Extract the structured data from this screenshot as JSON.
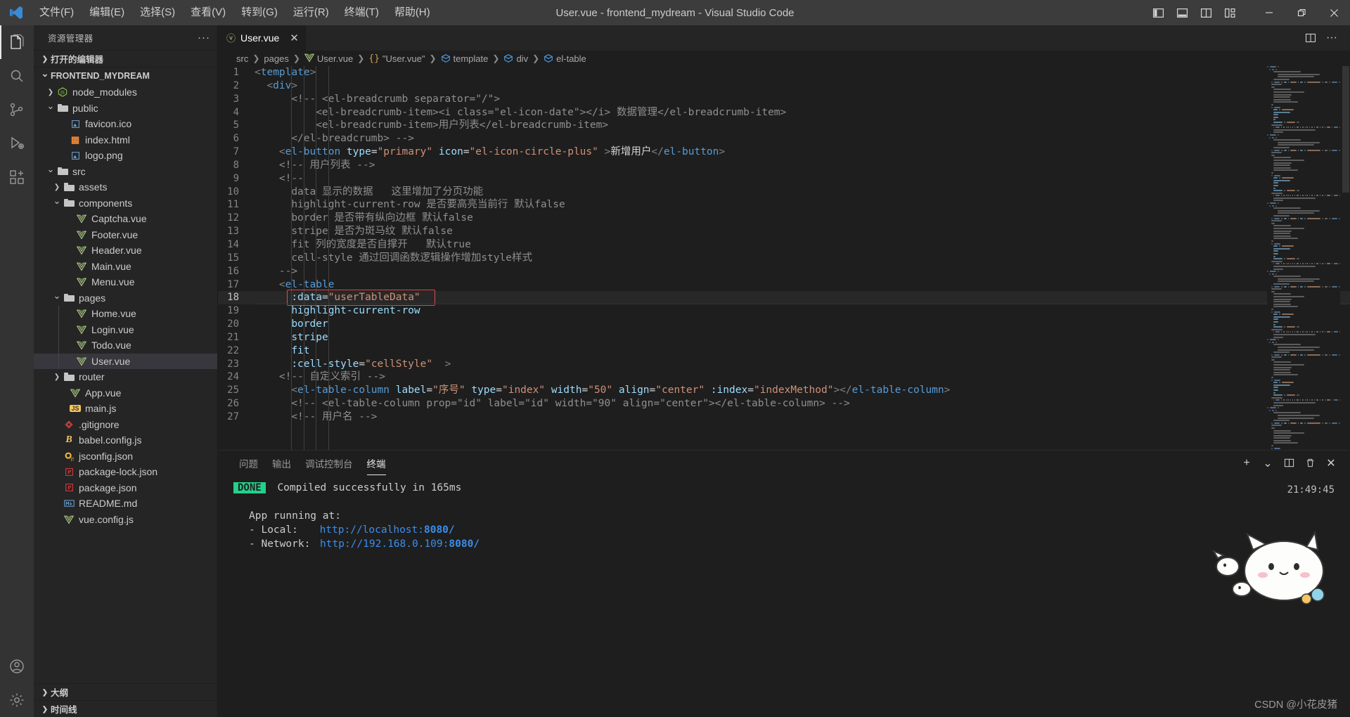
{
  "window": {
    "title": "User.vue - frontend_mydream - Visual Studio Code",
    "logo_icon": "vscode-logo-icon",
    "menus": [
      {
        "label": "文件(F)",
        "name": "menu-file"
      },
      {
        "label": "编辑(E)",
        "name": "menu-edit"
      },
      {
        "label": "选择(S)",
        "name": "menu-selection"
      },
      {
        "label": "查看(V)",
        "name": "menu-view"
      },
      {
        "label": "转到(G)",
        "name": "menu-go"
      },
      {
        "label": "运行(R)",
        "name": "menu-run"
      },
      {
        "label": "终端(T)",
        "name": "menu-terminal"
      },
      {
        "label": "帮助(H)",
        "name": "menu-help"
      }
    ],
    "layout_buttons": [
      {
        "icon": "toggle-primary-sidebar-icon"
      },
      {
        "icon": "toggle-panel-icon"
      },
      {
        "icon": "toggle-secondary-sidebar-icon"
      },
      {
        "icon": "customize-layout-icon"
      }
    ],
    "controls": [
      {
        "icon": "minimize-icon",
        "label": "—"
      },
      {
        "icon": "maximize-icon",
        "label": "❐"
      },
      {
        "icon": "close-icon",
        "label": "✕"
      }
    ]
  },
  "activitybar": [
    {
      "icon": "explorer-icon",
      "active": true
    },
    {
      "icon": "search-icon",
      "active": false
    },
    {
      "icon": "source-control-icon",
      "active": false
    },
    {
      "icon": "run-and-debug-icon",
      "active": false
    },
    {
      "icon": "extensions-icon",
      "active": false
    },
    {
      "icon": "accounts-icon",
      "active": false
    },
    {
      "icon": "settings-gear-icon",
      "active": false
    }
  ],
  "sidebar": {
    "title": "资源管理器",
    "more_icon": "ellipsis-icon",
    "sections": {
      "open_editors": "打开的编辑器",
      "project": "FRONTEND_MYDREAM",
      "outline": "大纲",
      "timeline": "时间线"
    },
    "tree": [
      {
        "label": "node_modules",
        "indent": 1,
        "icon": "nodejs-icon",
        "chevron": "right",
        "type": "folder"
      },
      {
        "label": "public",
        "indent": 1,
        "icon": "folder-icon",
        "chevron": "down",
        "type": "folder"
      },
      {
        "label": "favicon.ico",
        "indent": 3,
        "icon": "image-icon",
        "chevron": "",
        "type": "file"
      },
      {
        "label": "index.html",
        "indent": 3,
        "icon": "html-icon",
        "chevron": "",
        "type": "file"
      },
      {
        "label": "logo.png",
        "indent": 3,
        "icon": "image-icon",
        "chevron": "",
        "type": "file"
      },
      {
        "label": "src",
        "indent": 1,
        "icon": "folder-icon",
        "chevron": "down",
        "type": "folder"
      },
      {
        "label": "assets",
        "indent": 2,
        "icon": "folder-icon",
        "chevron": "right",
        "type": "folder"
      },
      {
        "label": "components",
        "indent": 2,
        "icon": "folder-icon",
        "chevron": "down",
        "type": "folder"
      },
      {
        "label": "Captcha.vue",
        "indent": 4,
        "icon": "vue-icon",
        "chevron": "",
        "type": "file"
      },
      {
        "label": "Footer.vue",
        "indent": 4,
        "icon": "vue-icon",
        "chevron": "",
        "type": "file"
      },
      {
        "label": "Header.vue",
        "indent": 4,
        "icon": "vue-icon",
        "chevron": "",
        "type": "file"
      },
      {
        "label": "Main.vue",
        "indent": 4,
        "icon": "vue-icon",
        "chevron": "",
        "type": "file"
      },
      {
        "label": "Menu.vue",
        "indent": 4,
        "icon": "vue-icon",
        "chevron": "",
        "type": "file"
      },
      {
        "label": "pages",
        "indent": 2,
        "icon": "folder-icon",
        "chevron": "down",
        "type": "folder"
      },
      {
        "label": "Home.vue",
        "indent": 4,
        "icon": "vue-icon",
        "chevron": "",
        "type": "file",
        "guide": true
      },
      {
        "label": "Login.vue",
        "indent": 4,
        "icon": "vue-icon",
        "chevron": "",
        "type": "file",
        "guide": true
      },
      {
        "label": "Todo.vue",
        "indent": 4,
        "icon": "vue-icon",
        "chevron": "",
        "type": "file",
        "guide": true
      },
      {
        "label": "User.vue",
        "indent": 4,
        "icon": "vue-icon",
        "chevron": "",
        "type": "file",
        "guide": true,
        "selected": true
      },
      {
        "label": "router",
        "indent": 2,
        "icon": "folder-icon",
        "chevron": "right",
        "type": "folder"
      },
      {
        "label": "App.vue",
        "indent": 3,
        "icon": "vue-icon",
        "chevron": "",
        "type": "file"
      },
      {
        "label": "main.js",
        "indent": 3,
        "icon": "js-icon",
        "chevron": "",
        "type": "file"
      },
      {
        "label": ".gitignore",
        "indent": 2,
        "icon": "git-icon",
        "chevron": "",
        "type": "file"
      },
      {
        "label": "babel.config.js",
        "indent": 2,
        "icon": "babel-icon",
        "chevron": "",
        "type": "file"
      },
      {
        "label": "jsconfig.json",
        "indent": 2,
        "icon": "jsconfig-icon",
        "chevron": "",
        "type": "file"
      },
      {
        "label": "package-lock.json",
        "indent": 2,
        "icon": "npm-icon",
        "chevron": "",
        "type": "file"
      },
      {
        "label": "package.json",
        "indent": 2,
        "icon": "npm-icon",
        "chevron": "",
        "type": "file"
      },
      {
        "label": "README.md",
        "indent": 2,
        "icon": "markdown-icon",
        "chevron": "",
        "type": "file"
      },
      {
        "label": "vue.config.js",
        "indent": 2,
        "icon": "vue-icon",
        "chevron": "",
        "type": "file"
      }
    ]
  },
  "editor": {
    "tab": {
      "label": "User.vue",
      "icon": "vue-icon",
      "close_icon": "close-icon"
    },
    "tab_actions": [
      {
        "icon": "split-editor-icon"
      },
      {
        "icon": "more-actions-icon"
      }
    ],
    "breadcrumbs": [
      {
        "label": "src",
        "icon": ""
      },
      {
        "label": "pages",
        "icon": ""
      },
      {
        "label": "User.vue",
        "icon": "vue-icon"
      },
      {
        "label": "\"User.vue\"",
        "icon": "braces-icon"
      },
      {
        "label": "template",
        "icon": "symbol-module-icon"
      },
      {
        "label": "div",
        "icon": "symbol-module-icon"
      },
      {
        "label": "el-table",
        "icon": "symbol-module-icon"
      }
    ],
    "highlight_value": ":data=\"userTableData\"",
    "highlight_line": 18,
    "cursor_line": 18,
    "lines": [
      {
        "n": 1,
        "tokens": [
          {
            "t": "brk",
            "v": "<"
          },
          {
            "t": "tag",
            "v": "template"
          },
          {
            "t": "brk",
            "v": ">"
          }
        ],
        "indent": 0
      },
      {
        "n": 2,
        "tokens": [
          {
            "t": "brk",
            "v": "<"
          },
          {
            "t": "tag",
            "v": "div"
          },
          {
            "t": "brk",
            "v": ">"
          }
        ],
        "indent": 1
      },
      {
        "n": 3,
        "tokens": [
          {
            "t": "cmt2",
            "v": "<!-- <el-breadcrumb separator=\"/\">"
          }
        ],
        "indent": 3
      },
      {
        "n": 4,
        "tokens": [
          {
            "t": "cmt2",
            "v": "<el-breadcrumb-item><i class=\"el-icon-date\"></i> 数据管理</el-breadcrumb-item>"
          }
        ],
        "indent": 5
      },
      {
        "n": 5,
        "tokens": [
          {
            "t": "cmt2",
            "v": "<el-breadcrumb-item>用户列表</el-breadcrumb-item>"
          }
        ],
        "indent": 5
      },
      {
        "n": 6,
        "tokens": [
          {
            "t": "cmt2",
            "v": "</el-breadcrumb> -->"
          }
        ],
        "indent": 3
      },
      {
        "n": 7,
        "tokens": [
          {
            "t": "brk",
            "v": "<"
          },
          {
            "t": "tag",
            "v": "el-button"
          },
          {
            "t": "txt",
            "v": " "
          },
          {
            "t": "attr",
            "v": "type"
          },
          {
            "t": "punct",
            "v": "="
          },
          {
            "t": "str",
            "v": "\"primary\""
          },
          {
            "t": "txt",
            "v": " "
          },
          {
            "t": "attr",
            "v": "icon"
          },
          {
            "t": "punct",
            "v": "="
          },
          {
            "t": "str",
            "v": "\"el-icon-circle-plus\""
          },
          {
            "t": "brk",
            "v": " >"
          },
          {
            "t": "txt",
            "v": "新增用户"
          },
          {
            "t": "brk",
            "v": "</"
          },
          {
            "t": "tag",
            "v": "el-button"
          },
          {
            "t": "brk",
            "v": ">"
          }
        ],
        "indent": 2
      },
      {
        "n": 8,
        "tokens": [
          {
            "t": "cmt2",
            "v": "<!-- 用户列表 -->"
          }
        ],
        "indent": 2
      },
      {
        "n": 9,
        "tokens": [
          {
            "t": "cmt2",
            "v": "<!--"
          }
        ],
        "indent": 2
      },
      {
        "n": 10,
        "tokens": [
          {
            "t": "cmt2",
            "v": "data 显示的数据   这里增加了分页功能"
          }
        ],
        "indent": 3
      },
      {
        "n": 11,
        "tokens": [
          {
            "t": "cmt2",
            "v": "highlight-current-row 是否要高亮当前行 默认false"
          }
        ],
        "indent": 3
      },
      {
        "n": 12,
        "tokens": [
          {
            "t": "cmt2",
            "v": "border 是否带有纵向边框 默认false"
          }
        ],
        "indent": 3
      },
      {
        "n": 13,
        "tokens": [
          {
            "t": "cmt2",
            "v": "stripe 是否为斑马纹 默认false"
          }
        ],
        "indent": 3
      },
      {
        "n": 14,
        "tokens": [
          {
            "t": "cmt2",
            "v": "fit 列的宽度是否自撑开   默认true"
          }
        ],
        "indent": 3
      },
      {
        "n": 15,
        "tokens": [
          {
            "t": "cmt2",
            "v": "cell-style 通过回调函数逻辑操作增加style样式"
          }
        ],
        "indent": 3
      },
      {
        "n": 16,
        "tokens": [
          {
            "t": "cmt2",
            "v": "-->"
          }
        ],
        "indent": 2
      },
      {
        "n": 17,
        "tokens": [
          {
            "t": "brk",
            "v": "<"
          },
          {
            "t": "tag",
            "v": "el-table"
          }
        ],
        "indent": 2
      },
      {
        "n": 18,
        "tokens": [
          {
            "t": "attr",
            "v": ":data"
          },
          {
            "t": "punct",
            "v": "="
          },
          {
            "t": "str",
            "v": "\"userTableData\""
          }
        ],
        "indent": 3
      },
      {
        "n": 19,
        "tokens": [
          {
            "t": "attr",
            "v": "highlight-current-row"
          }
        ],
        "indent": 3
      },
      {
        "n": 20,
        "tokens": [
          {
            "t": "attr",
            "v": "border"
          }
        ],
        "indent": 3
      },
      {
        "n": 21,
        "tokens": [
          {
            "t": "attr",
            "v": "stripe"
          }
        ],
        "indent": 3
      },
      {
        "n": 22,
        "tokens": [
          {
            "t": "attr",
            "v": "fit"
          }
        ],
        "indent": 3
      },
      {
        "n": 23,
        "tokens": [
          {
            "t": "attr",
            "v": ":cell-style"
          },
          {
            "t": "punct",
            "v": "="
          },
          {
            "t": "str",
            "v": "\"cellStyle\""
          },
          {
            "t": "brk",
            "v": "  >"
          }
        ],
        "indent": 3
      },
      {
        "n": 24,
        "tokens": [
          {
            "t": "cmt2",
            "v": "<!-- 自定义索引 -->"
          }
        ],
        "indent": 2
      },
      {
        "n": 25,
        "tokens": [
          {
            "t": "brk",
            "v": "<"
          },
          {
            "t": "tag",
            "v": "el-table-column"
          },
          {
            "t": "txt",
            "v": " "
          },
          {
            "t": "attr",
            "v": "label"
          },
          {
            "t": "punct",
            "v": "="
          },
          {
            "t": "str",
            "v": "\"序号\""
          },
          {
            "t": "txt",
            "v": " "
          },
          {
            "t": "attr",
            "v": "type"
          },
          {
            "t": "punct",
            "v": "="
          },
          {
            "t": "str",
            "v": "\"index\""
          },
          {
            "t": "txt",
            "v": " "
          },
          {
            "t": "attr",
            "v": "width"
          },
          {
            "t": "punct",
            "v": "="
          },
          {
            "t": "str",
            "v": "\"50\""
          },
          {
            "t": "txt",
            "v": " "
          },
          {
            "t": "attr",
            "v": "align"
          },
          {
            "t": "punct",
            "v": "="
          },
          {
            "t": "str",
            "v": "\"center\""
          },
          {
            "t": "txt",
            "v": " "
          },
          {
            "t": "attr",
            "v": ":index"
          },
          {
            "t": "punct",
            "v": "="
          },
          {
            "t": "str",
            "v": "\"indexMethod\""
          },
          {
            "t": "brk",
            "v": "></"
          },
          {
            "t": "tag",
            "v": "el-table-column"
          },
          {
            "t": "brk",
            "v": ">"
          }
        ],
        "indent": 3
      },
      {
        "n": 26,
        "tokens": [
          {
            "t": "cmt2",
            "v": "<!-- <el-table-column prop=\"id\" label=\"id\" width=\"90\" align=\"center\"></el-table-column> -->"
          }
        ],
        "indent": 3
      },
      {
        "n": 27,
        "tokens": [
          {
            "t": "cmt2",
            "v": "<!-- 用户名 -->"
          }
        ],
        "indent": 3
      }
    ]
  },
  "panel": {
    "tabs": [
      {
        "label": "问题",
        "active": false
      },
      {
        "label": "输出",
        "active": false
      },
      {
        "label": "调试控制台",
        "active": false
      },
      {
        "label": "终端",
        "active": true
      }
    ],
    "actions": [
      {
        "icon": "add-terminal-icon",
        "label": "+"
      },
      {
        "icon": "chevron-down-icon",
        "label": "⌄"
      },
      {
        "icon": "split-terminal-icon",
        "label": "▥"
      },
      {
        "icon": "trash-icon",
        "label": "🗑"
      },
      {
        "icon": "close-panel-icon",
        "label": "✕"
      }
    ],
    "terminal": {
      "status_badge": "DONE",
      "status_text": "Compiled successfully in 165ms",
      "app_running_label": "App running at:",
      "local_label": "- Local:",
      "local_url": "http://localhost:",
      "local_port": "8080/",
      "network_label": "- Network:",
      "network_url": "http://192.168.0.109:",
      "network_port": "8080/",
      "timestamp": "21:49:45"
    }
  },
  "watermark": "CSDN @小花皮猪",
  "colors": {
    "accent_green": "#23d18b",
    "link_blue": "#3b8eea",
    "highlight_red": "#e04a4a",
    "tag_blue": "#569cd6",
    "string_orange": "#ce9178",
    "attr_cyan": "#9cdcfe"
  }
}
